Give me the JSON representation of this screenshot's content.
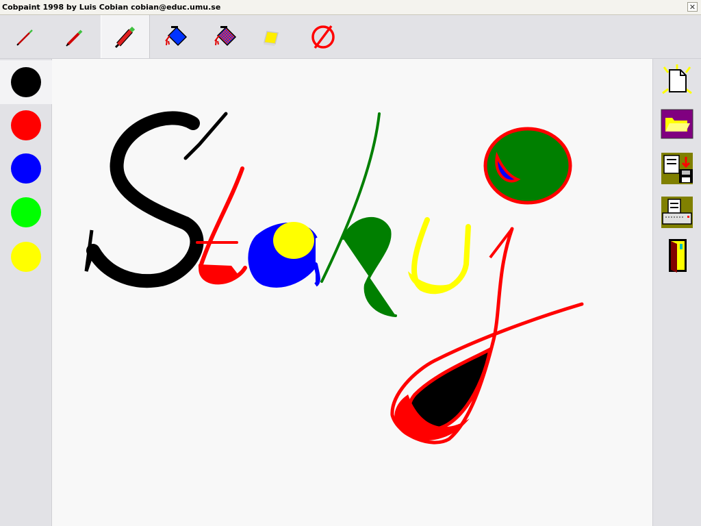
{
  "window": {
    "title": "Cobpaint 1998 by Luis Cobian  cobian@educ.umu.se",
    "close_glyph": "✕"
  },
  "toolbar": {
    "tools": [
      {
        "name": "thin-pencil",
        "icon": "thin-pencil-icon"
      },
      {
        "name": "medium-pencil",
        "icon": "medium-pencil-icon"
      },
      {
        "name": "thick-pencil",
        "icon": "thick-pencil-icon",
        "selected": true
      },
      {
        "name": "fill-bucket",
        "icon": "paint-bucket-icon"
      },
      {
        "name": "pattern-fill",
        "icon": "pattern-bucket-icon"
      },
      {
        "name": "eraser",
        "icon": "eraser-icon"
      },
      {
        "name": "clear",
        "icon": "clear-canvas-icon"
      }
    ]
  },
  "palette": {
    "colors": [
      "#000000",
      "#ff0000",
      "#0000ff",
      "#00ff00",
      "#ffff00"
    ],
    "selected_index": 0
  },
  "sidebar": {
    "buttons": [
      {
        "name": "new",
        "icon": "new-document-icon"
      },
      {
        "name": "open",
        "icon": "open-folder-icon"
      },
      {
        "name": "save",
        "icon": "save-disk-icon"
      },
      {
        "name": "print",
        "icon": "printer-icon"
      },
      {
        "name": "exit",
        "icon": "exit-door-icon"
      }
    ]
  },
  "drawing": {
    "stroke_colors": {
      "black": "#000000",
      "red": "#ff0000",
      "blue": "#0000ff",
      "yellow": "#ffff00",
      "green": "#007f00"
    }
  }
}
